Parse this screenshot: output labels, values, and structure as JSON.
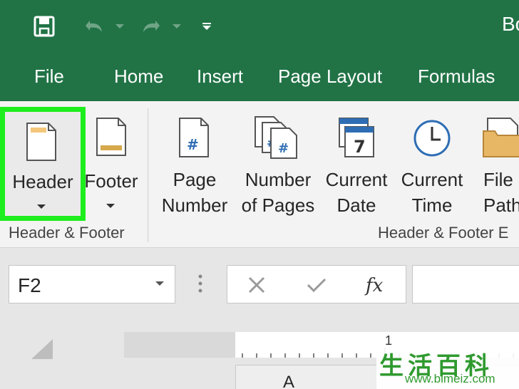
{
  "window": {
    "title_partial": "Bo"
  },
  "menu": {
    "tabs": [
      "File",
      "Home",
      "Insert",
      "Page Layout",
      "Formulas"
    ]
  },
  "ribbon": {
    "header_label": "Header",
    "footer_label": "Footer",
    "page_number": [
      "Page",
      "Number"
    ],
    "number_of_pages": [
      "Number",
      "of Pages"
    ],
    "current_date": [
      "Current",
      "Date"
    ],
    "current_time": [
      "Current",
      "Time"
    ],
    "file_path": [
      "File",
      "Path"
    ],
    "group_header_footer": "Header & Footer",
    "group_header_footer_elements": "Header & Footer E",
    "calendar_day": "7"
  },
  "formula_bar": {
    "name_box_value": "F2"
  },
  "sheet": {
    "ruler_number": "1",
    "column_a": "A"
  },
  "watermark": {
    "chars": "生活百科",
    "url": "www.bimeiz.com"
  },
  "colors": {
    "excel_green": "#217346",
    "highlight": "#1dee1d",
    "icon_blue": "#2e6db4",
    "header_orange": "#f4c77a"
  },
  "icons": [
    "save-icon",
    "undo-icon",
    "redo-icon",
    "customize-qat-icon",
    "header-icon",
    "footer-icon",
    "page-number-icon",
    "number-of-pages-icon",
    "current-date-icon",
    "current-time-icon",
    "file-path-icon",
    "cancel-icon",
    "enter-icon",
    "fx-icon"
  ]
}
